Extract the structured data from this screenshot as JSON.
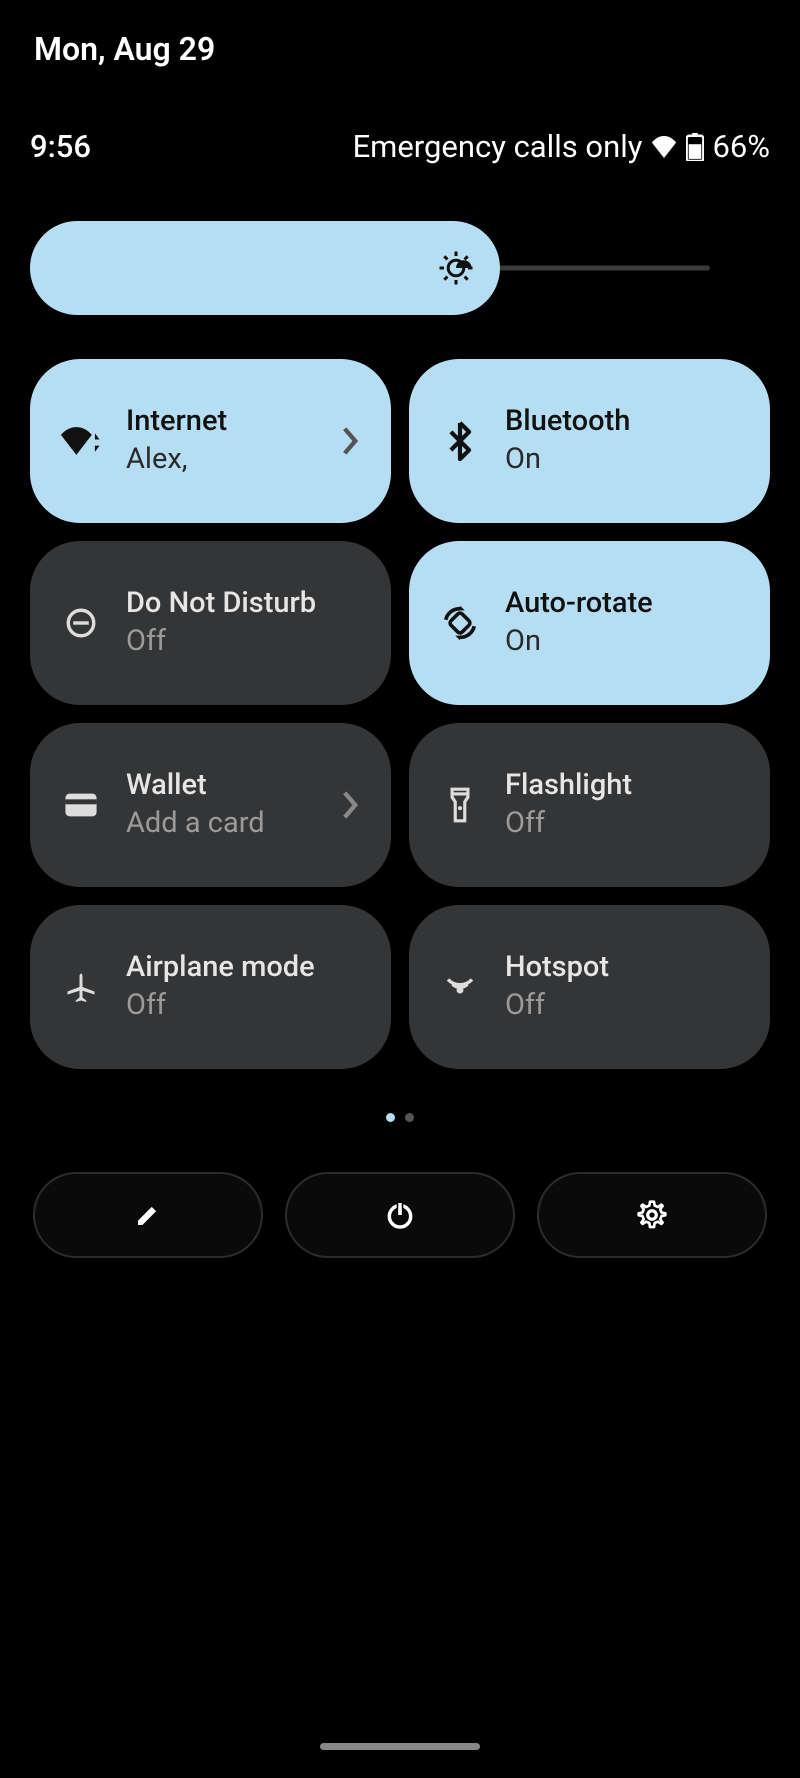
{
  "header": {
    "date": "Mon, Aug 29",
    "time": "9:56",
    "status_text": "Emergency calls only",
    "battery_pct": "66%"
  },
  "brightness": {
    "value_pct": 65
  },
  "tiles": [
    {
      "id": "internet",
      "title": "Internet",
      "subtitle": "Alex,",
      "state": "on",
      "chevron": true
    },
    {
      "id": "bluetooth",
      "title": "Bluetooth",
      "subtitle": "On",
      "state": "on",
      "chevron": false
    },
    {
      "id": "dnd",
      "title": "Do Not Disturb",
      "subtitle": "Off",
      "state": "off",
      "chevron": false
    },
    {
      "id": "autorotate",
      "title": "Auto-rotate",
      "subtitle": "On",
      "state": "on",
      "chevron": false
    },
    {
      "id": "wallet",
      "title": "Wallet",
      "subtitle": "Add a card",
      "state": "off",
      "chevron": true
    },
    {
      "id": "flashlight",
      "title": "Flashlight",
      "subtitle": "Off",
      "state": "off",
      "chevron": false
    },
    {
      "id": "airplane",
      "title": "Airplane mode",
      "subtitle": "Off",
      "state": "off",
      "chevron": false
    },
    {
      "id": "hotspot",
      "title": "Hotspot",
      "subtitle": "Off",
      "state": "off",
      "chevron": false
    }
  ],
  "pager": {
    "count": 2,
    "active": 0
  },
  "footer": {
    "edit": "edit",
    "power": "power",
    "settings": "settings"
  }
}
